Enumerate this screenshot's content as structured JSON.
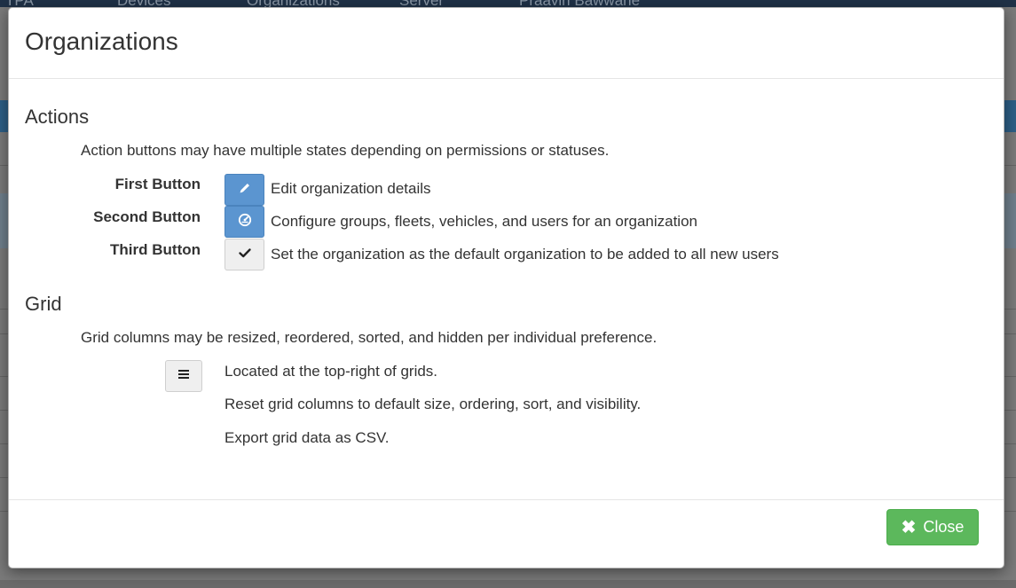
{
  "background": {
    "nav_items": [
      {
        "label": "TPA",
        "icon": "gauge-icon"
      },
      {
        "label": "Devices",
        "icon": "device-icon"
      },
      {
        "label": "Organizations",
        "icon": "org-icon"
      },
      {
        "label": "Server",
        "icon": "server-icon"
      },
      {
        "label": "Praavin Bawwane",
        "icon": "user-icon"
      },
      {
        "label": "",
        "icon": "plus-icon"
      }
    ]
  },
  "modal": {
    "title": "Organizations",
    "actions": {
      "heading": "Actions",
      "description": "Action buttons may have multiple states depending on permissions or statuses.",
      "rows": [
        {
          "label": "First Button",
          "icon": "pencil-icon",
          "text": "Edit organization details"
        },
        {
          "label": "Second Button",
          "icon": "dashboard-icon",
          "text": "Configure groups, fleets, vehicles, and users for an organization"
        },
        {
          "label": "Third Button",
          "icon": "check-icon",
          "text": "Set the organization as the default organization to be added to all new users"
        }
      ]
    },
    "grid": {
      "heading": "Grid",
      "description": "Grid columns may be resized, reordered, sorted, and hidden per individual preference.",
      "menu_icon": "menu-icon",
      "lines": [
        "Located at the top-right of grids.",
        "Reset grid columns to default size, ordering, sort, and visibility.",
        "Export grid data as CSV."
      ]
    },
    "footer": {
      "close_label": "Close",
      "close_icon": "close-icon"
    }
  },
  "colors": {
    "primary": "#5b95d0",
    "success": "#5cb85c",
    "navbar": "#1f3147"
  }
}
